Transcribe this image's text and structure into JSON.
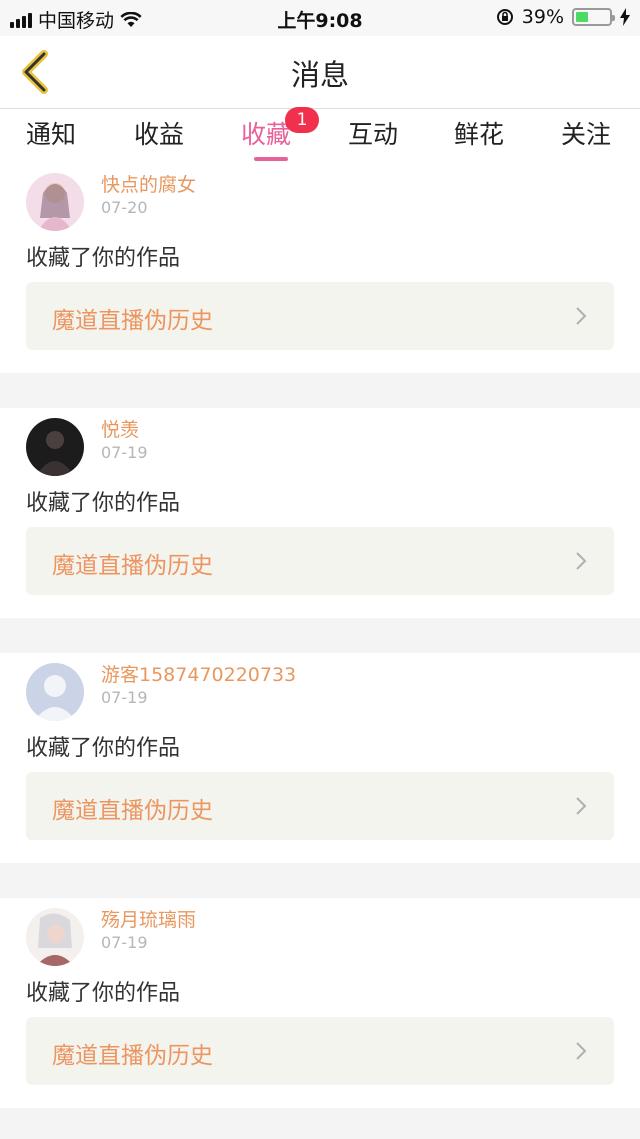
{
  "status_bar": {
    "carrier": "中国移动",
    "time": "上午9:08",
    "battery": "39%",
    "battery_level": 0.39
  },
  "nav": {
    "title": "消息",
    "back_icon": "chevron-left-icon"
  },
  "tabs": [
    {
      "label": "通知"
    },
    {
      "label": "收益"
    },
    {
      "label": "收藏",
      "badge": "1",
      "active": true
    },
    {
      "label": "互动"
    },
    {
      "label": "鲜花"
    },
    {
      "label": "关注"
    }
  ],
  "items": [
    {
      "username": "快点的腐女",
      "date": "07-20",
      "action": "收藏了你的作品",
      "work_title": "魔道直播伪历史"
    },
    {
      "username": "悦羡",
      "date": "07-19",
      "action": "收藏了你的作品",
      "work_title": "魔道直播伪历史"
    },
    {
      "username": "游客1587470220733",
      "date": "07-19",
      "action": "收藏了你的作品",
      "work_title": "魔道直播伪历史"
    },
    {
      "username": "殇月琉璃雨",
      "date": "07-19",
      "action": "收藏了你的作品",
      "work_title": "魔道直播伪历史"
    }
  ],
  "colors": {
    "accent": "#e8629a",
    "username": "#e8985f",
    "badge": "#f0304d"
  }
}
